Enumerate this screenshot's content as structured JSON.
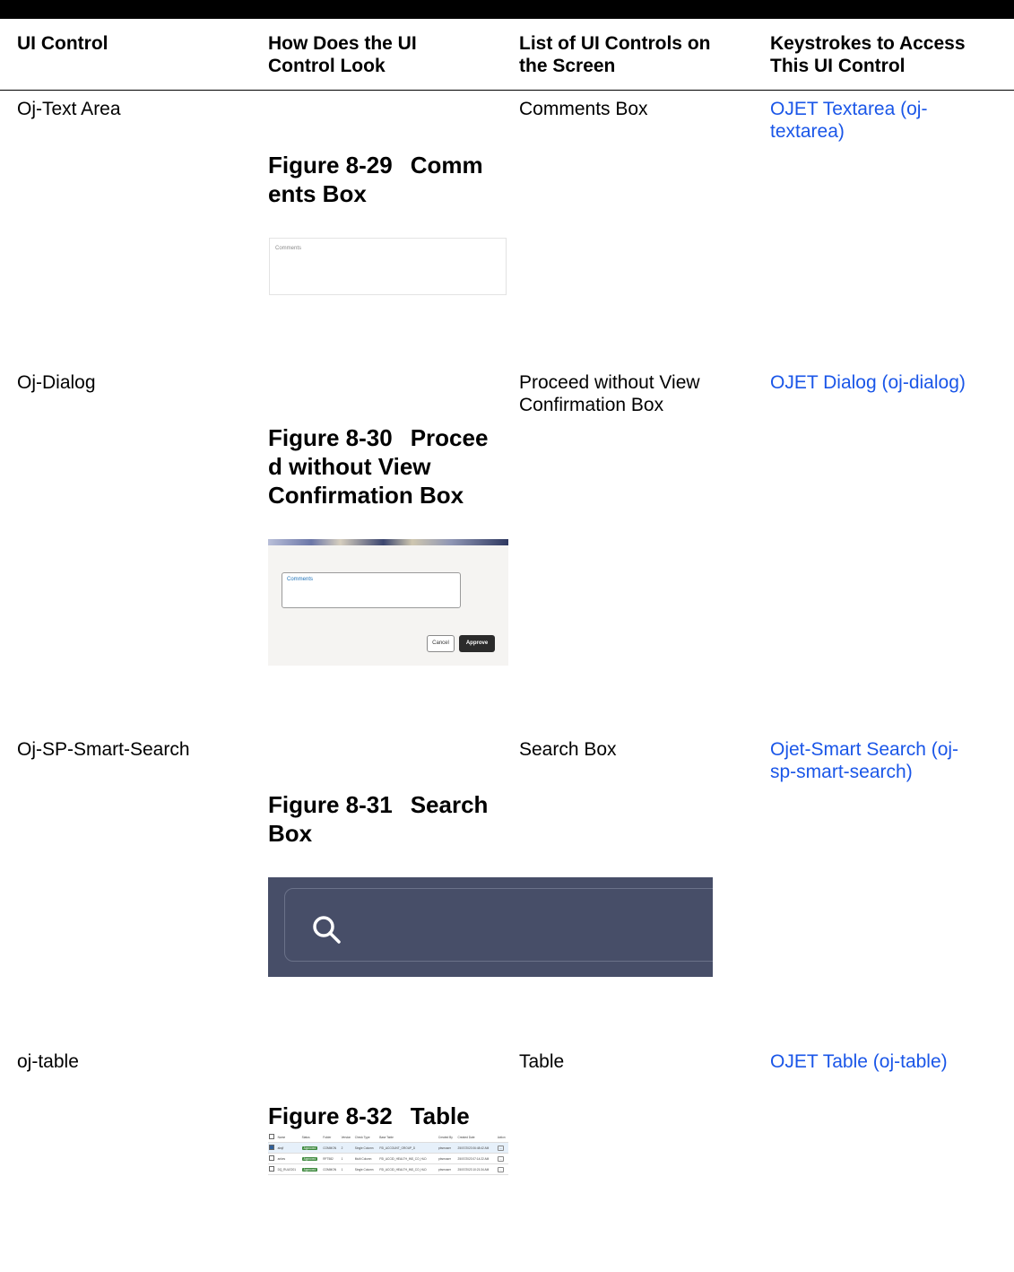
{
  "headers": {
    "col1": "UI Control",
    "col2a": "How Does the UI",
    "col2b": "Control Look",
    "col3a": "List of UI Controls on",
    "col3b": "the Screen",
    "col4a": "Keystrokes to Access",
    "col4b": "This UI Control"
  },
  "rows": [
    {
      "control": "Oj-Text Area",
      "figure_num": "Figure 8-29",
      "figure_line1": "Comm",
      "figure_line2": "ents Box",
      "list_line1": "Comments Box",
      "link_line1": "OJET Textarea (oj-",
      "link_line2": "textarea)"
    },
    {
      "control": "Oj-Dialog",
      "figure_num": "Figure 8-30",
      "figure_line1": "Procee",
      "figure_line2": "d without View",
      "figure_line3": "Confirmation Box",
      "list_line1": "Proceed without View",
      "list_line2": "Confirmation Box",
      "link_line1": "OJET Dialog (oj-dialog)"
    },
    {
      "control": "Oj-SP-Smart-Search",
      "figure_num": "Figure 8-31",
      "figure_line1": "Search",
      "figure_line2": "Box",
      "list_line1": "Search Box",
      "link_line1": "Ojet-Smart Search (oj-",
      "link_line2": "sp-smart-search)"
    },
    {
      "control": "oj-table",
      "figure_num": "Figure 8-32",
      "figure_line1": "Table",
      "list_line1": "Table",
      "link_line1": "OJET Table (oj-table)"
    }
  ],
  "fig_comments": {
    "label": "Comments"
  },
  "fig_dialog": {
    "label": "Comments",
    "cancel": "Cancel",
    "approve": "Approve"
  },
  "fig_search": {
    "icon": "search-icon"
  },
  "fig_table": {
    "columns": [
      "Name",
      "Status",
      "Folder",
      "Version",
      "Check Type",
      "Base Table",
      "Created By",
      "Created Date",
      "Action"
    ],
    "rows": [
      [
        "aksjf",
        "Approved",
        "COMMON",
        "2",
        "Single Column",
        "FSI_ACCOUNT_GROUP_D",
        "pbsmuser",
        "25/07/2023 06:48:42 AM",
        "..."
      ],
      [
        "ankes",
        "Approved",
        "RFT582",
        "1",
        "Multi Column",
        "FSI_ACCID_HEALTH_INS_CO_HLD",
        "pbsmuser",
        "25/07/2023 07:14:22 AM",
        "..."
      ],
      [
        "DQ_RULE201",
        "Approved",
        "COMMON",
        "1",
        "Single Column",
        "FSI_ACCID_HEALTH_INS_CO_HLD",
        "pbsmuser",
        "25/07/2023 10:21:34 AM",
        "..."
      ]
    ]
  }
}
